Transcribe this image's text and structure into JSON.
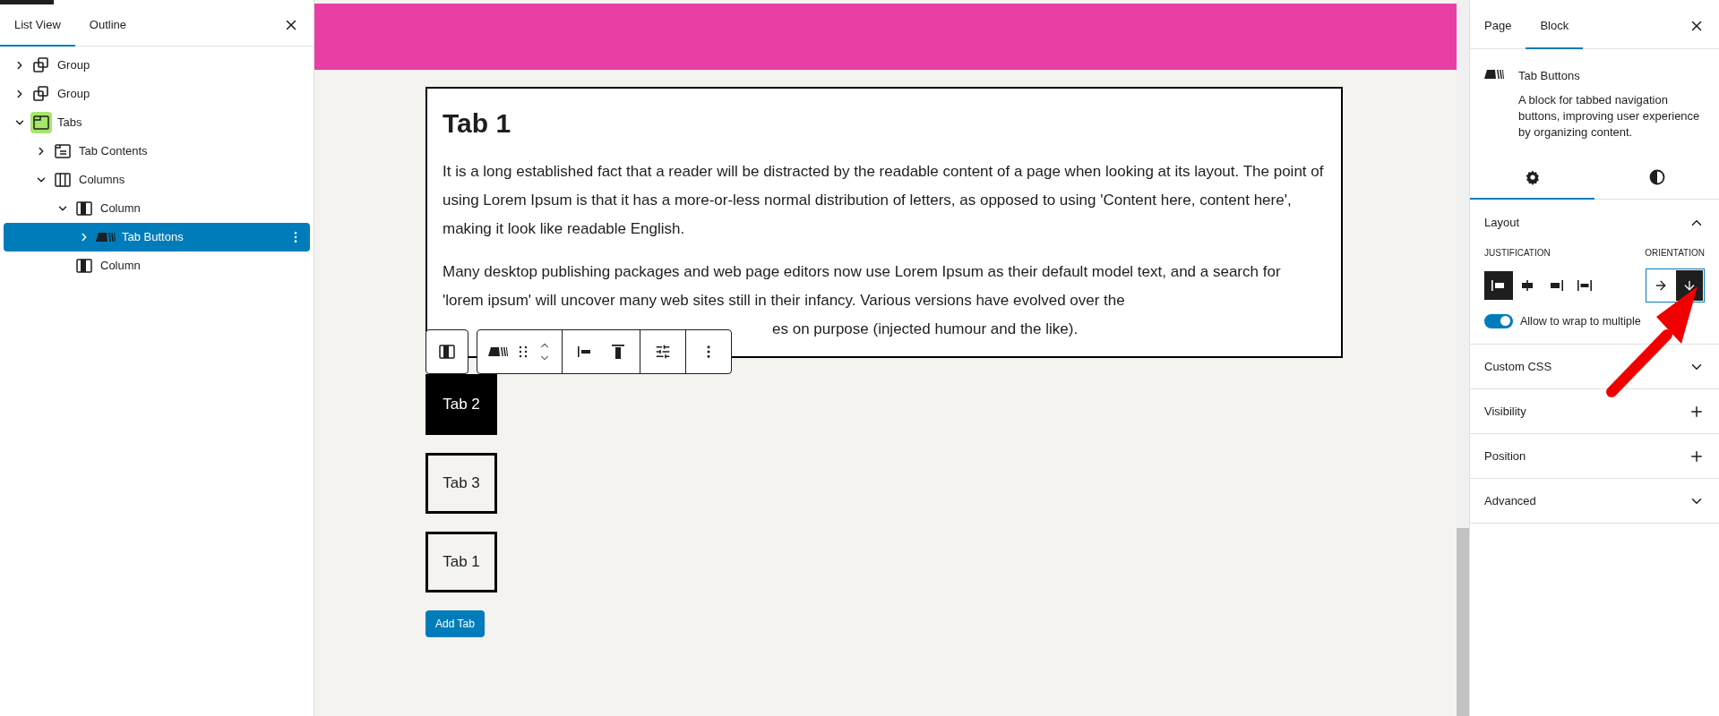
{
  "list_panel": {
    "tabs": [
      {
        "label": "List View",
        "selected": true
      },
      {
        "label": "Outline",
        "selected": false
      }
    ],
    "tree": [
      {
        "label": "Group",
        "kind": "group",
        "expanded": false,
        "selected": false
      },
      {
        "label": "Group",
        "kind": "group",
        "expanded": false,
        "selected": false
      },
      {
        "label": "Tabs",
        "kind": "tabs",
        "expanded": true,
        "selected": false,
        "children": [
          {
            "label": "Tab Contents",
            "kind": "tab-contents",
            "expanded": false,
            "selected": false
          },
          {
            "label": "Columns",
            "kind": "columns",
            "expanded": true,
            "selected": false,
            "children": [
              {
                "label": "Column",
                "kind": "column",
                "expanded": true,
                "selected": false,
                "children": [
                  {
                    "label": "Tab Buttons",
                    "kind": "tab-buttons",
                    "expanded": false,
                    "selected": true
                  }
                ]
              },
              {
                "label": "Column",
                "kind": "column",
                "selected": false
              }
            ]
          }
        ]
      }
    ]
  },
  "canvas": {
    "heading": "Tab 1",
    "paragraphs": [
      "It is a long established fact that a reader will be distracted by the readable content of a page when looking at its layout. The point of using Lorem Ipsum is that it has a more-or-less normal distribution of letters, as opposed to using 'Content here, content here', making it look like readable English.",
      "Many desktop publishing packages and web page editors now use Lorem Ipsum as their default model text, and a search for 'lorem ipsum' will uncover many web sites still in their infancy. Various versions have evolved over the"
    ],
    "paragraph_tail": "es on purpose (injected humour and the like).",
    "tab_buttons": [
      {
        "label": "Tab 2",
        "selected": true
      },
      {
        "label": "Tab 3",
        "selected": false
      },
      {
        "label": "Tab 1",
        "selected": false
      }
    ],
    "add_button": "Add Tab"
  },
  "settings": {
    "tabs": [
      {
        "label": "Page",
        "selected": false
      },
      {
        "label": "Block",
        "selected": true
      }
    ],
    "block": {
      "title": "Tab Buttons",
      "description": "A block for tabbed navigation buttons, improving user experience by organizing content."
    },
    "icon_tabs": [
      {
        "kind": "settings",
        "selected": true
      },
      {
        "kind": "styles",
        "selected": false
      }
    ],
    "layout": {
      "title": "Layout",
      "expanded": true,
      "justification_label": "JUSTIFICATION",
      "justification": [
        {
          "kind": "left",
          "selected": true
        },
        {
          "kind": "center",
          "selected": false
        },
        {
          "kind": "right",
          "selected": false
        },
        {
          "kind": "space-between",
          "selected": false
        }
      ],
      "orientation_label": "ORIENTATION",
      "orientation": [
        {
          "kind": "horizontal",
          "selected": false
        },
        {
          "kind": "vertical",
          "selected": true
        }
      ],
      "wrap_toggle": {
        "label": "Allow to wrap to multiple",
        "on": true
      }
    },
    "sections": [
      {
        "title": "Custom CSS",
        "kind": "chevron",
        "expanded": false
      },
      {
        "title": "Visibility",
        "kind": "plus",
        "expanded": false
      },
      {
        "title": "Position",
        "kind": "plus",
        "expanded": false
      },
      {
        "title": "Advanced",
        "kind": "chevron",
        "expanded": false
      }
    ]
  }
}
